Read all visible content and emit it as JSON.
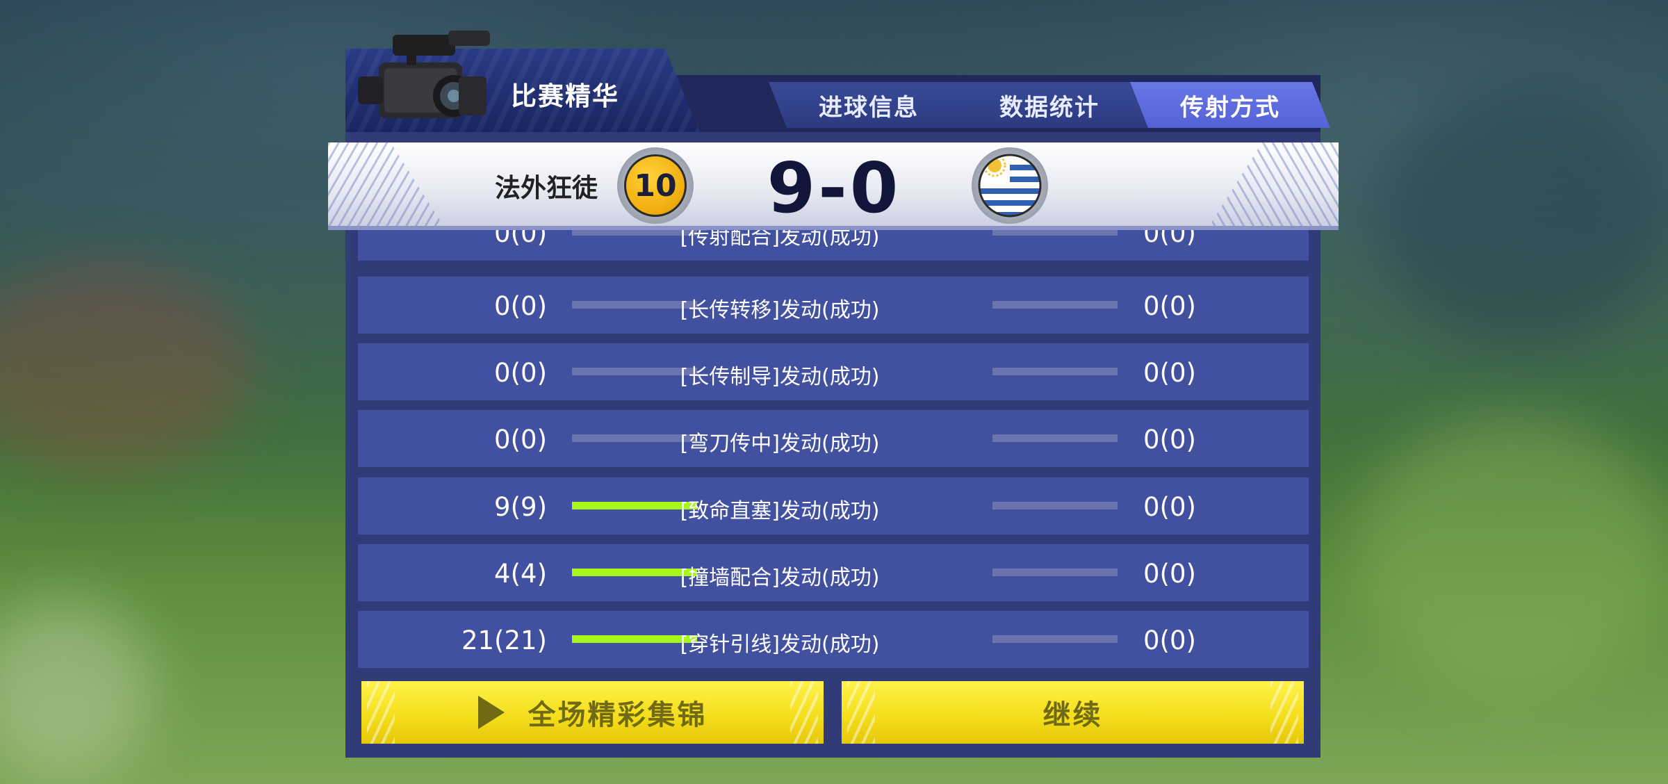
{
  "header": {
    "title": "比赛精华",
    "tabs": [
      {
        "label": "进球信息",
        "active": false
      },
      {
        "label": "数据统计",
        "active": false
      },
      {
        "label": "传射方式",
        "active": true
      }
    ]
  },
  "match": {
    "home_team": "法外狂徒",
    "home_badge_number": "10",
    "score": "9-0",
    "away_team": "乌拉圭"
  },
  "stats": [
    {
      "label": "[传射配合]发动(成功)",
      "left": "0(0)",
      "right": "0(0)",
      "left_fill": 0,
      "right_fill": 0
    },
    {
      "label": "[长传转移]发动(成功)",
      "left": "0(0)",
      "right": "0(0)",
      "left_fill": 0,
      "right_fill": 0
    },
    {
      "label": "[长传制导]发动(成功)",
      "left": "0(0)",
      "right": "0(0)",
      "left_fill": 0,
      "right_fill": 0
    },
    {
      "label": "[弯刀传中]发动(成功)",
      "left": "0(0)",
      "right": "0(0)",
      "left_fill": 0,
      "right_fill": 0
    },
    {
      "label": "[致命直塞]发动(成功)",
      "left": "9(9)",
      "right": "0(0)",
      "left_fill": 1,
      "right_fill": 0
    },
    {
      "label": "[撞墙配合]发动(成功)",
      "left": "4(4)",
      "right": "0(0)",
      "left_fill": 1,
      "right_fill": 0
    },
    {
      "label": "[穿针引线]发动(成功)",
      "left": "21(21)",
      "right": "0(0)",
      "left_fill": 1,
      "right_fill": 0
    }
  ],
  "buttons": {
    "highlights_label": "全场精彩集锦",
    "continue_label": "继续"
  },
  "icons": {
    "camera": "video-camera-icon",
    "play": "play-icon",
    "badge": "team-badge-icon",
    "flag": "uruguay-flag-icon"
  },
  "colors": {
    "panel": "#303b78",
    "row": "#4250a0",
    "active_tab": "#5462d6",
    "bar_fill": "#a6f51c",
    "button": "#f3dc1a"
  }
}
